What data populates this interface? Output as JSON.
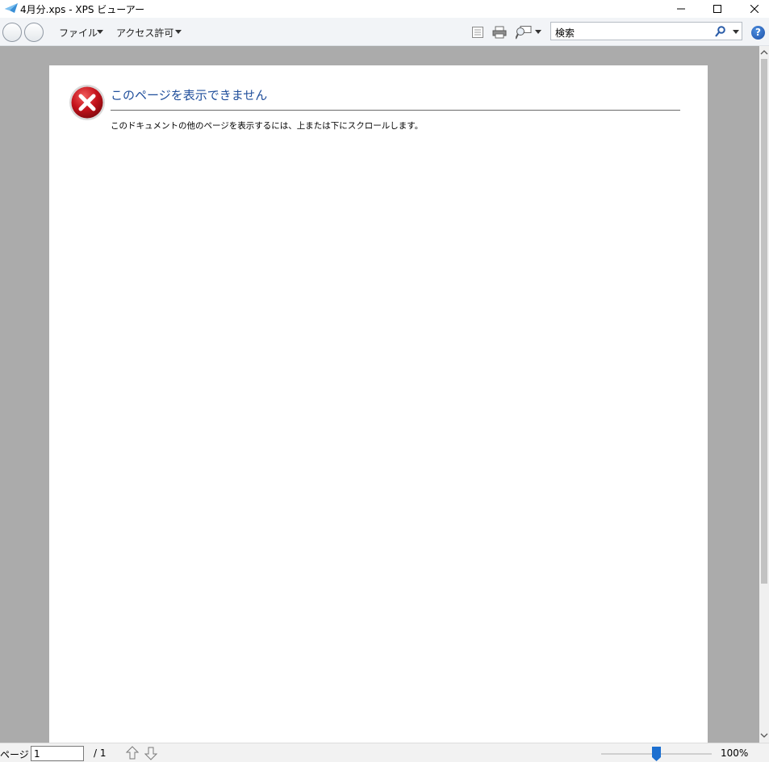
{
  "window": {
    "title": "4月分.xps - XPS ビューアー",
    "icon": "xps-viewer-app-icon"
  },
  "toolbar": {
    "file_menu": "ファイル",
    "access_menu": "アクセス許可",
    "search_value": "検索"
  },
  "document": {
    "error_title": "このページを表示できません",
    "error_message": "このドキュメントの他のページを表示するには、上または下にスクロールします。"
  },
  "statusbar": {
    "page_label": "ページ",
    "page_value": "1",
    "page_total": "/ 1",
    "zoom_label": "100%",
    "zoom_level_fraction": 0.5
  },
  "colors": {
    "error_title": "#1f4e9b",
    "viewer_background": "#ababab",
    "zoom_thumb": "#1c6fd0"
  }
}
